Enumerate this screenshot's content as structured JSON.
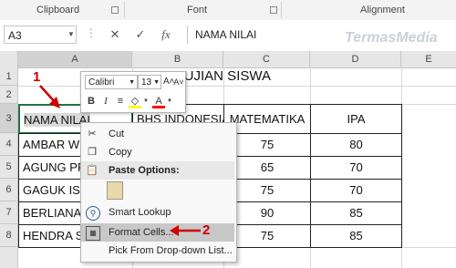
{
  "ribbon": {
    "groups": [
      "Clipboard",
      "Font",
      "Alignment"
    ]
  },
  "formula_bar": {
    "name_box": "A3",
    "cancel_symbol": "✕",
    "enter_symbol": "✓",
    "fx_symbol": "fx",
    "formula": "NAMA NILAI"
  },
  "watermark": "TermasMedia",
  "sheet": {
    "columns": [
      "A",
      "B",
      "C",
      "D",
      "E"
    ],
    "rows": [
      "1",
      "2",
      "3",
      "4",
      "5",
      "6",
      "7",
      "8"
    ],
    "title": "NILAI UJIAN SISWA",
    "headers": [
      "NAMA NILAI",
      "BHS INDONESIA",
      "MATEMATIKA",
      "IPA"
    ],
    "data": [
      {
        "name": "AMBAR WID",
        "mat": "75",
        "ipa": "80"
      },
      {
        "name": "AGUNG PRA",
        "mat": "65",
        "ipa": "70"
      },
      {
        "name": "GAGUK ISM",
        "mat": "75",
        "ipa": "70"
      },
      {
        "name": "BERLIANA P",
        "mat": "90",
        "ipa": "85"
      },
      {
        "name": "HENDRA SE",
        "mat": "75",
        "ipa": "85"
      }
    ]
  },
  "mini_toolbar": {
    "font": "Calibri",
    "size": "13",
    "grow": "A˄",
    "shrink": "A˅",
    "bold": "B",
    "italic": "I",
    "align": "≡",
    "fill": "◇",
    "font_color": "A"
  },
  "context_menu": {
    "items": [
      "Cut",
      "Copy",
      "Paste Options:",
      "Smart Lookup",
      "Format Cells...",
      "Pick From Drop-down List..."
    ]
  },
  "annotations": {
    "step1": "1",
    "step2": "2"
  },
  "colors": {
    "annotation": "#d00000",
    "selected_cell_fill": "#d9d9d9",
    "highlight_row": "#c8c8c8"
  }
}
